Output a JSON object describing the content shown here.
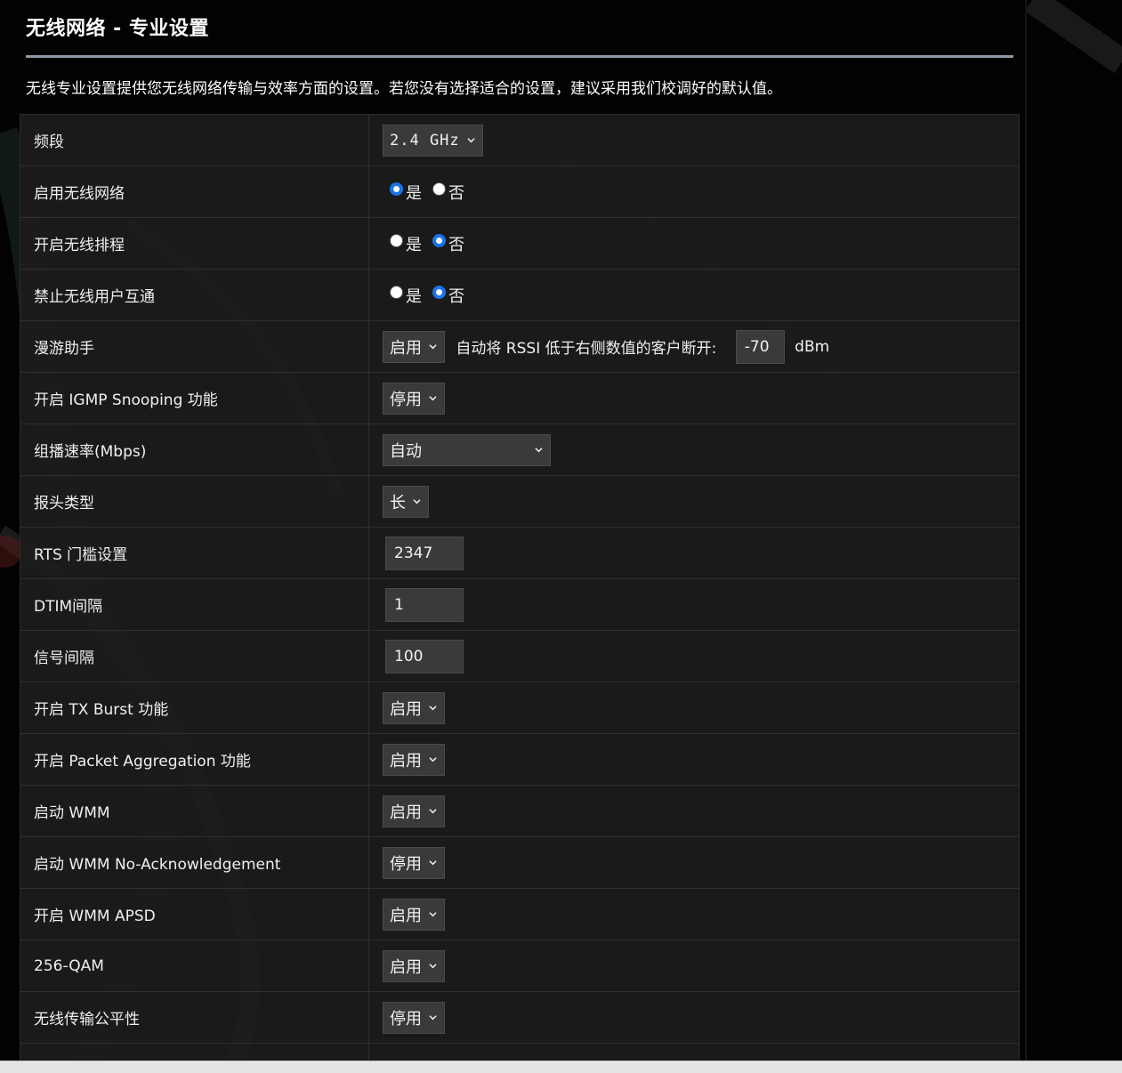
{
  "page": {
    "title": "无线网络 - 专业设置",
    "description": "无线专业设置提供您无线网络传输与效率方面的设置。若您没有选择适合的设置，建议采用我们校调好的默认值。"
  },
  "rows": {
    "band": {
      "label": "频段",
      "value": "2.4 GHz"
    },
    "enable_radio": {
      "label": "启用无线网络",
      "yes": "是",
      "no": "否",
      "selected": "yes"
    },
    "wireless_scheduler": {
      "label": "开启无线排程",
      "yes": "是",
      "no": "否",
      "selected": "no"
    },
    "ap_isolation": {
      "label": "禁止无线用户互通",
      "yes": "是",
      "no": "否",
      "selected": "no"
    },
    "roaming": {
      "label": "漫游助手",
      "value": "启用",
      "text": "自动将 RSSI 低于右侧数值的客户断开:",
      "rssi": "-70",
      "unit": "dBm"
    },
    "igmp": {
      "label": "开启 IGMP Snooping 功能",
      "value": "停用"
    },
    "multicast_rate": {
      "label": "组播速率(Mbps)",
      "value": "自动"
    },
    "preamble": {
      "label": "报头类型",
      "value": "长"
    },
    "rts": {
      "label": "RTS 门槛设置",
      "value": "2347"
    },
    "dtim": {
      "label": "DTIM间隔",
      "value": "1"
    },
    "beacon": {
      "label": "信号间隔",
      "value": "100"
    },
    "tx_burst": {
      "label": "开启 TX Burst 功能",
      "value": "启用"
    },
    "packet_aggregation": {
      "label": "开启 Packet Aggregation 功能",
      "value": "启用"
    },
    "wmm": {
      "label": "启动 WMM",
      "value": "启用"
    },
    "wmm_noack": {
      "label": "启动 WMM No-Acknowledgement",
      "value": "停用"
    },
    "wmm_apsd": {
      "label": "开启 WMM APSD",
      "value": "启用"
    },
    "qam256": {
      "label": "256-QAM",
      "value": "启用"
    },
    "airtime_fairness": {
      "label": "无线传输公平性",
      "value": "停用"
    }
  },
  "colors": {
    "background": "#020202",
    "table_bg": "#1c1c1c",
    "select_bg": "#3a3a3a",
    "radio_accent": "#1a73e8",
    "title_rule": "#8e9aa6"
  }
}
